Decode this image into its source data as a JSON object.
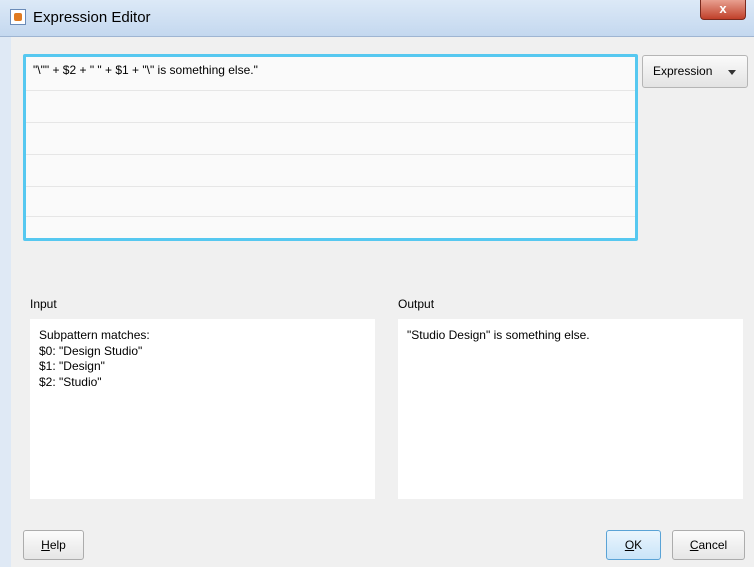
{
  "window": {
    "title": "Expression Editor",
    "close_label": "x"
  },
  "editor": {
    "expression": "\"\\\"\" + $2 + \" \" + $1 + \"\\\" is something else.\""
  },
  "expression_menu": {
    "label": "Expression"
  },
  "input_panel": {
    "label": "Input",
    "lines": [
      "Subpattern matches:",
      "$0: \"Design Studio\"",
      "$1: \"Design\"",
      "$2: \"Studio\""
    ]
  },
  "output_panel": {
    "label": "Output",
    "lines": [
      "\"Studio Design\" is something else."
    ]
  },
  "buttons": {
    "help_mnemonic": "H",
    "help_rest": "elp",
    "ok_mnemonic": "O",
    "ok_rest": "K",
    "cancel_mnemonic": "C",
    "cancel_rest": "ancel"
  },
  "colors": {
    "editor_focus_border": "#56c8f0",
    "default_button_border": "#5aa3d6"
  }
}
